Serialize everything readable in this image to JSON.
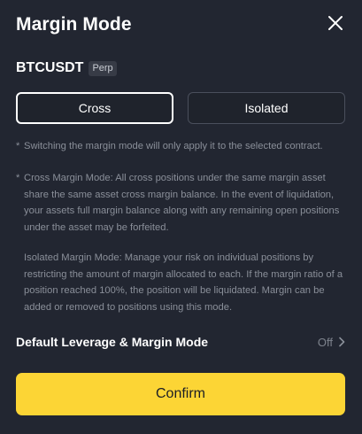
{
  "header": {
    "title": "Margin Mode",
    "close_icon": "close-icon"
  },
  "contract": {
    "symbol": "BTCUSDT",
    "badge": "Perp"
  },
  "mode_toggle": {
    "options": [
      "Cross",
      "Isolated"
    ],
    "selected": "Cross"
  },
  "descriptions": {
    "bullet": "*",
    "note": "Switching the margin mode will only apply it to the selected contract.",
    "cross": "Cross Margin Mode: All cross positions under the same margin asset share the same asset cross margin balance. In the event of liquidation, your assets full margin balance along with any remaining open positions under the asset may be forfeited.",
    "isolated": "Isolated Margin Mode: Manage your risk on individual positions by restricting the amount of margin allocated to each. If the margin ratio of a position reached 100%, the position will be liquidated. Margin can be added or removed to positions using this mode."
  },
  "leverage": {
    "label": "Default Leverage & Margin Mode",
    "value": "Off",
    "icon": "chevron-right-icon"
  },
  "confirm": {
    "label": "Confirm"
  },
  "colors": {
    "background": "#222631",
    "accent": "#fcd535",
    "text_secondary": "#8a8f99"
  }
}
